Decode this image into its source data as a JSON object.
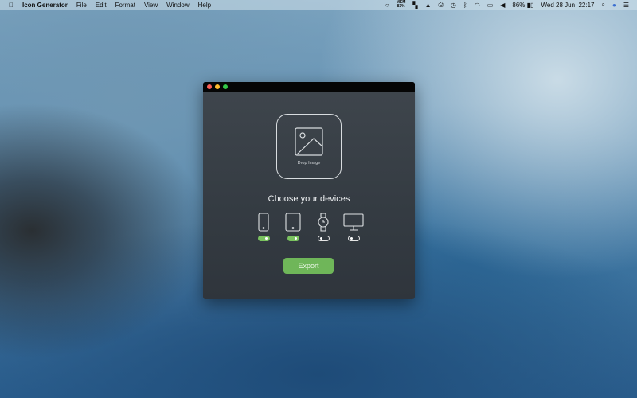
{
  "menubar": {
    "app_name": "Icon Generator",
    "menus": [
      "File",
      "Edit",
      "Format",
      "View",
      "Window",
      "Help"
    ],
    "status": {
      "mem_label": "MEM",
      "mem_value": "83%",
      "battery": "86%",
      "date": "Wed 28 Jun",
      "time": "22:17"
    }
  },
  "window": {
    "drop_label": "Drop Image",
    "heading": "Choose your devices",
    "devices": [
      {
        "name": "iPhone",
        "enabled": true
      },
      {
        "name": "iPad",
        "enabled": true
      },
      {
        "name": "Watch",
        "enabled": false
      },
      {
        "name": "Mac",
        "enabled": false
      }
    ],
    "export_label": "Export"
  },
  "colors": {
    "accent": "#6fb659"
  }
}
